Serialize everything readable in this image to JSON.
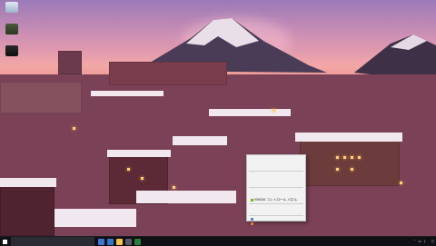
{
  "desktop": {
    "icons": [
      {
        "name": "recycle-bin-icon",
        "label": ""
      },
      {
        "name": "app-icon-1",
        "label": ""
      },
      {
        "name": "app-icon-2",
        "label": ""
      }
    ]
  },
  "context_menu": {
    "items": [
      {
        "label": "",
        "shortcut": ""
      },
      {
        "label": "",
        "shortcut": ""
      },
      {
        "label": "",
        "shortcut": ""
      },
      {
        "label": "",
        "shortcut": ""
      },
      {
        "label": "",
        "shortcut": ""
      },
      {
        "label": "",
        "shortcut": ""
      },
      {
        "label": "",
        "shortcut": ""
      },
      {
        "label": "",
        "shortcut": ""
      },
      {
        "label": "NVIDIA コントロール パネル",
        "shortcut": ""
      },
      {
        "label": "",
        "shortcut": ""
      },
      {
        "label": "",
        "shortcut": ""
      },
      {
        "label": "",
        "shortcut": ""
      },
      {
        "label": "",
        "shortcut": ""
      }
    ]
  },
  "taskbar": {
    "search_placeholder": "",
    "clock_time": "",
    "clock_date": ""
  }
}
